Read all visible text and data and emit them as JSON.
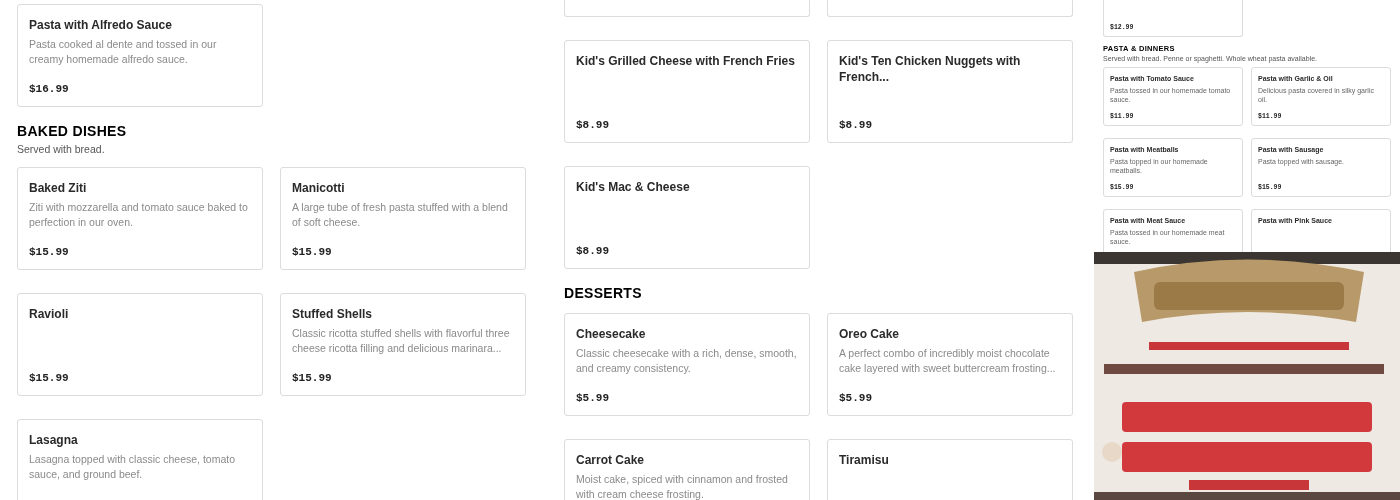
{
  "columns": [
    {
      "kind": "menu",
      "sections": [
        {
          "items": [
            {
              "kind": "dish",
              "name": "Pasta with Alfredo Sauce",
              "description": "Pasta cooked al dente and tossed in our creamy homemade alfredo sauce.",
              "price": "$16.99"
            }
          ]
        },
        {
          "heading": "BAKED DISHES",
          "subtitle": "Served with bread.",
          "items": [
            {
              "kind": "dish",
              "name": "Baked Ziti",
              "description": "Ziti with mozzarella and tomato sauce baked to perfection in our oven.",
              "price": "$15.99"
            },
            {
              "kind": "dish",
              "name": "Manicotti",
              "description": "A large tube of fresh pasta stuffed with a blend of soft cheese.",
              "price": "$15.99"
            },
            {
              "kind": "dish",
              "name": "Ravioli",
              "price": "$15.99"
            },
            {
              "kind": "dish",
              "name": "Stuffed Shells",
              "description": "Classic ricotta stuffed shells with flavorful three cheese ricotta filling and delicious marinara...",
              "price": "$15.99"
            },
            {
              "kind": "dish",
              "name": "Lasagna",
              "description": "Lasagna topped with classic cheese, tomato sauce, and ground beef."
            }
          ]
        }
      ]
    },
    {
      "kind": "menu",
      "sections": [
        {
          "items": [
            {
              "kind": "cut"
            },
            {
              "kind": "cut"
            },
            {
              "kind": "dish",
              "name": "Kid's Grilled Cheese with French Fries",
              "price": "$8.99"
            },
            {
              "kind": "dish",
              "name": "Kid's Ten Chicken Nuggets with French...",
              "price": "$8.99"
            },
            {
              "kind": "dish",
              "name": "Kid's Mac & Cheese",
              "price": "$8.99"
            }
          ]
        },
        {
          "heading": "DESSERTS",
          "items": [
            {
              "kind": "dish",
              "name": "Cheesecake",
              "description": "Classic cheesecake with a rich, dense, smooth, and creamy consistency.",
              "price": "$5.99"
            },
            {
              "kind": "dish",
              "name": "Oreo Cake",
              "description": "A perfect combo of incredibly moist chocolate cake layered with sweet buttercream frosting...",
              "price": "$5.99"
            },
            {
              "kind": "dish",
              "name": "Carrot Cake",
              "description": "Moist cake, spiced with cinnamon and frosted with cream cheese frosting."
            },
            {
              "kind": "dish",
              "name": "Tiramisu"
            }
          ]
        }
      ]
    },
    {
      "kind": "stack",
      "parts": [
        {
          "kind": "mini_menu",
          "sections": [
            {
              "items": [
                {
                  "kind": "cut",
                  "price": "$12.99"
                }
              ]
            },
            {
              "heading": "PASTA & DINNERS",
              "subtitle": "Served with bread. Penne or spaghetti. Whole wheat pasta available.",
              "items": [
                {
                  "kind": "dish",
                  "name": "Pasta with Tomato Sauce",
                  "description": "Pasta tossed in our homemade tomato sauce.",
                  "price": "$11.99"
                },
                {
                  "kind": "dish",
                  "name": "Pasta with Garlic & Oil",
                  "description": "Delicious pasta covered in silky garlic oil.",
                  "price": "$11.99"
                },
                {
                  "kind": "dish",
                  "name": "Pasta with Meatballs",
                  "description": "Pasta topped in our homemade meatballs.",
                  "price": "$15.99"
                },
                {
                  "kind": "dish",
                  "name": "Pasta with Sausage",
                  "description": "Pasta topped with sausage.",
                  "price": "$15.99"
                },
                {
                  "kind": "dish",
                  "name": "Pasta with Meat Sauce",
                  "description": "Pasta tossed in our homemade meat sauce."
                },
                {
                  "kind": "dish",
                  "name": "Pasta with Pink Sauce"
                }
              ]
            }
          ]
        },
        {
          "kind": "picture"
        }
      ]
    }
  ]
}
